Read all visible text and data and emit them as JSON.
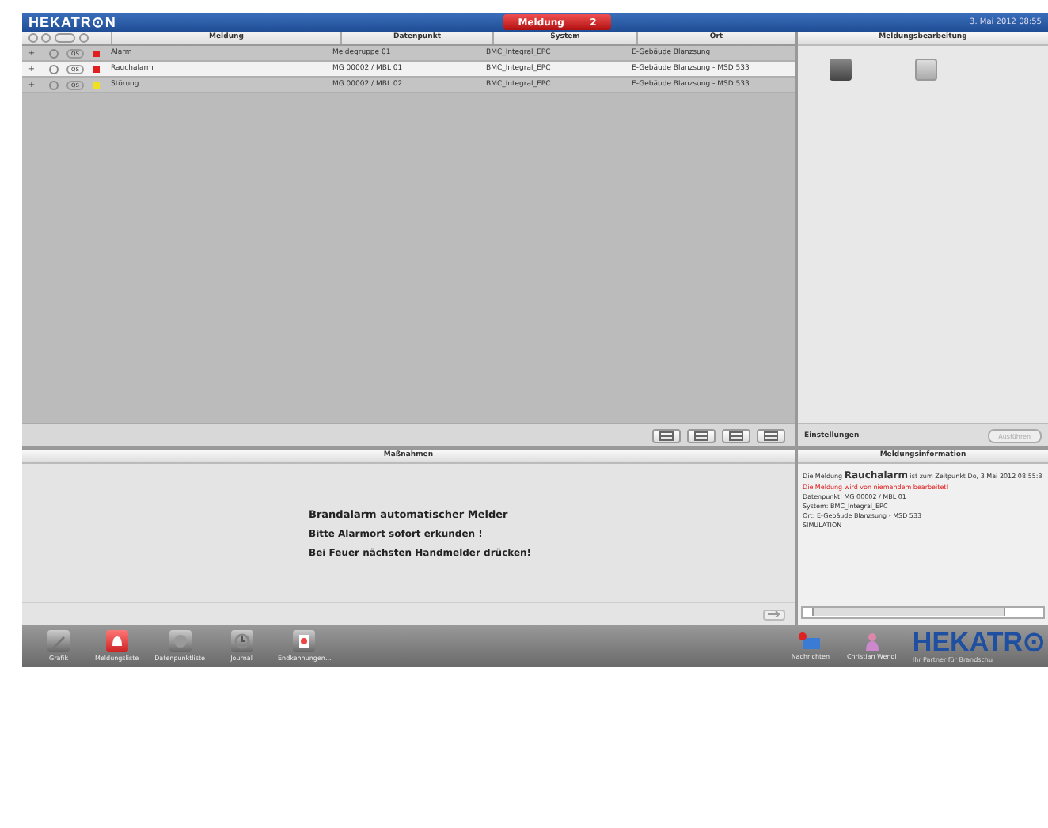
{
  "header": {
    "logo": "HEKATR⊙N",
    "alert_tab": {
      "label": "Meldung",
      "count": "2"
    },
    "datetime": "3. Mai 2012 08:55"
  },
  "table": {
    "columns": [
      "Meldung",
      "Datenpunkt",
      "System",
      "Ort"
    ],
    "rows": [
      {
        "expander": "+",
        "button": "QS",
        "color": "#e02020",
        "meldung": "Alarm",
        "datenpunkt": "Meldegruppe 01",
        "system": "BMC_Integral_EPC",
        "ort": "E-Gebäude Blanzsung",
        "selected": false
      },
      {
        "expander": "+",
        "button": "QS",
        "color": "#e02020",
        "meldung": "Rauchalarm",
        "datenpunkt": "MG 00002 / MBL 01",
        "system": "BMC_Integral_EPC",
        "ort": "E-Gebäude Blanzsung - MSD 533",
        "selected": true
      },
      {
        "expander": "+",
        "button": "QS",
        "color": "#f0e020",
        "meldung": "Störung",
        "datenpunkt": "MG 00002 / MBL 02",
        "system": "BMC_Integral_EPC",
        "ort": "E-Gebäude Blanzsung - MSD 533",
        "selected": false
      }
    ]
  },
  "processing": {
    "title": "Meldungsbearbeitung",
    "settings": "Einstellungen",
    "execute": {
      "label": "Ausführen",
      "disabled": true
    }
  },
  "measures": {
    "title": "Maßnahmen",
    "lines": [
      "Brandalarm automatischer Melder",
      "Bitte Alarmort sofort erkunden !",
      "Bei Feuer nächsten Handmelder drücken!"
    ]
  },
  "info": {
    "title": "Meldungsinformation",
    "lines": [
      {
        "kind": "normal",
        "text": "Die Meldung **Rauchalarm** ist zum Zeitpunkt Do, 3 Mai 2012 08:55:3"
      },
      {
        "kind": "warning",
        "text": "Die Meldung wird von niemandem bearbeitet!"
      },
      {
        "kind": "normal",
        "text": "Datenpunkt: MG 00002 / MBL 01"
      },
      {
        "kind": "normal",
        "text": "System: BMC_Integral_EPC"
      },
      {
        "kind": "normal",
        "text": "Ort: E-Gebäude Blanzsung - MSD 533"
      },
      {
        "kind": "normal",
        "text": "SIMULATION"
      }
    ]
  },
  "taskbar": {
    "items": [
      {
        "kind": "pencil",
        "label": "Grafik",
        "selected": false
      },
      {
        "kind": "bell",
        "label": "Meldungsliste",
        "selected": true
      },
      {
        "kind": "gauge",
        "label": "Datenpunktliste",
        "selected": false
      },
      {
        "kind": "clock",
        "label": "Journal",
        "selected": false
      },
      {
        "kind": "doc",
        "label": "Endkennungen...",
        "selected": false
      }
    ],
    "messages": "Nachrichten",
    "user": "Christian Wendl",
    "brand": "HEKATR⊙",
    "slogan": "Ihr Partner für Brandschu"
  }
}
